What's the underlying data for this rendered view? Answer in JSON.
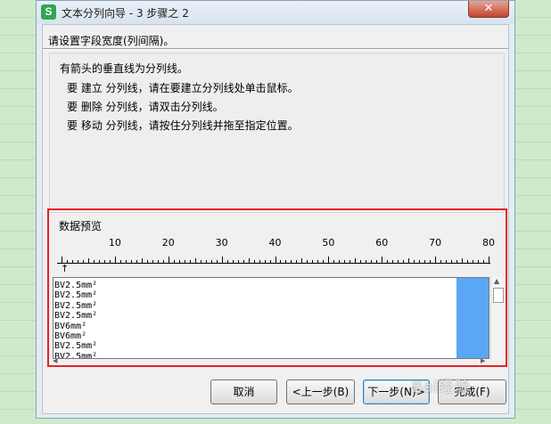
{
  "window": {
    "title": "文本分列向导 - 3 步骤之 2",
    "app_icon_glyph": "S",
    "close_glyph": "✕"
  },
  "prompt": "请设置字段宽度(列间隔)。",
  "info": {
    "heading": "有箭头的垂直线为分列线。",
    "lines": [
      "要 建立 分列线，请在要建立分列线处单击鼠标。",
      "要 删除 分列线，请双击分列线。",
      "要 移动 分列线，请按住分列线并拖至指定位置。"
    ]
  },
  "preview": {
    "group_label": "数据预览",
    "ruler_numbers": [
      "10",
      "20",
      "30",
      "40",
      "50",
      "60",
      "70",
      "80"
    ],
    "column_break_marker": "↑",
    "rows": [
      "BV2.5mm²",
      "BV2.5mm²",
      "BV2.5mm²",
      "BV2.5mm²",
      "BV6mm²",
      "BV6mm²",
      "BV2.5mm²",
      "BV2.5mm²"
    ],
    "selected_column_color": "#5aa8f5"
  },
  "buttons": {
    "cancel": "取消",
    "back": "<上一步(B)",
    "next": "下一步(N)>",
    "finish": "完成(F)"
  },
  "watermark": "Bai经验",
  "colors": {
    "highlight_border": "#e8202a"
  }
}
